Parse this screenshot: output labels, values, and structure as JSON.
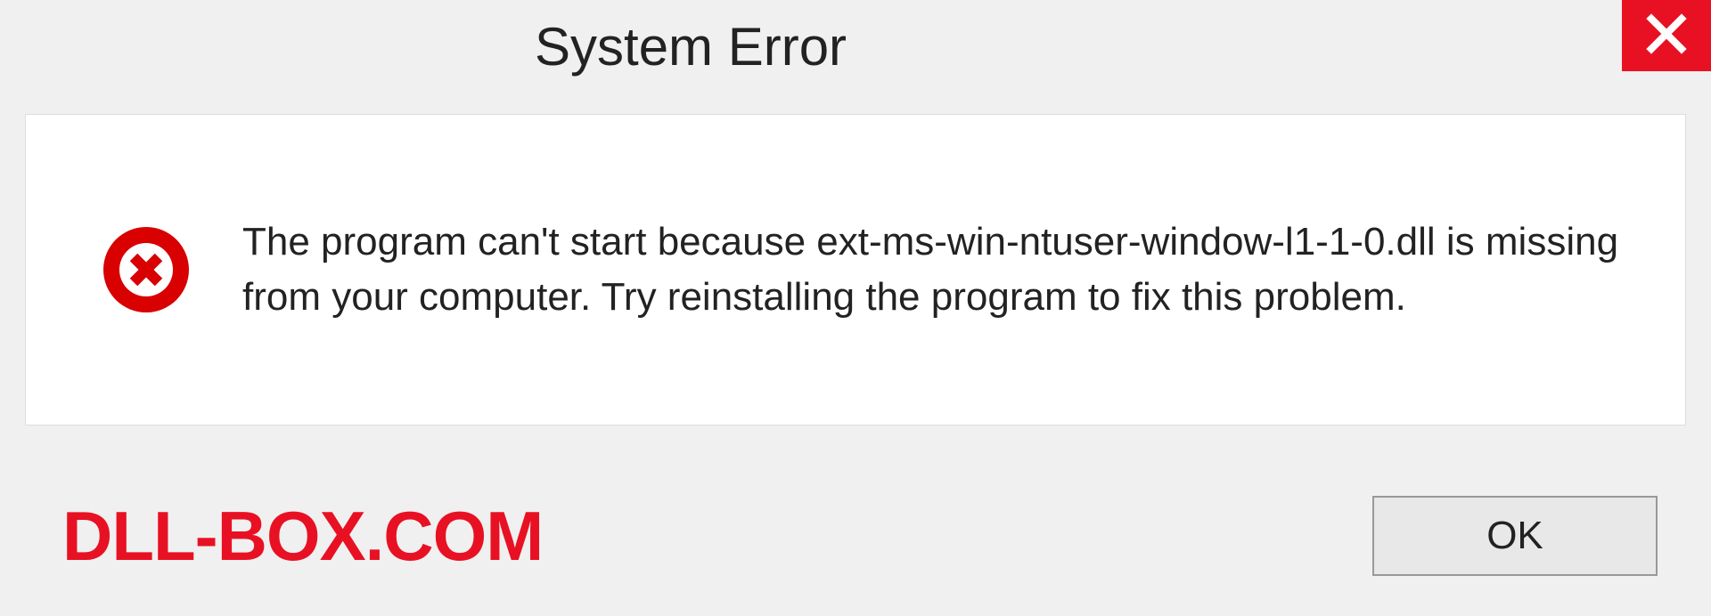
{
  "dialog": {
    "title": "System Error",
    "message": "The program can't start because ext-ms-win-ntuser-window-l1-1-0.dll is missing from your computer. Try reinstalling the program to fix this problem.",
    "ok_label": "OK"
  },
  "watermark": "DLL-BOX.COM",
  "colors": {
    "close_bg": "#e81123",
    "error_icon": "#d80000",
    "watermark": "#e81123"
  }
}
